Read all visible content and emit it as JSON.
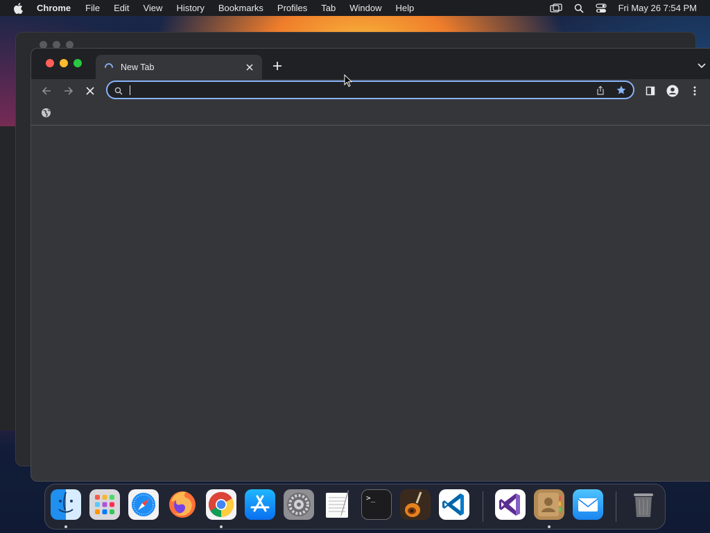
{
  "menubar": {
    "app_name": "Chrome",
    "items": [
      "File",
      "Edit",
      "View",
      "History",
      "Bookmarks",
      "Profiles",
      "Tab",
      "Window",
      "Help"
    ],
    "clock": "Fri May 26  7:54 PM",
    "status_icons": [
      "screen-mirroring-icon",
      "spotlight-search-icon",
      "control-center-icon"
    ]
  },
  "browser": {
    "tab_title": "New Tab",
    "tab_state": "loading",
    "omnibox": {
      "value": "",
      "placeholder": "",
      "focused": true
    },
    "accent_color": "#8ab4f8",
    "bookmark_color": "#8ab4f8"
  },
  "dock": {
    "apps": [
      {
        "name": "Finder",
        "icon": "finder-icon",
        "running": true
      },
      {
        "name": "Launchpad",
        "icon": "launchpad-icon",
        "running": false
      },
      {
        "name": "Safari",
        "icon": "safari-icon",
        "running": false
      },
      {
        "name": "Firefox",
        "icon": "firefox-icon",
        "running": false
      },
      {
        "name": "Google Chrome",
        "icon": "chrome-icon",
        "running": true
      },
      {
        "name": "App Store",
        "icon": "app-store-icon",
        "running": false
      },
      {
        "name": "System Preferences",
        "icon": "system-preferences-icon",
        "running": false
      },
      {
        "name": "TextEdit",
        "icon": "textedit-icon",
        "running": false
      },
      {
        "name": "Terminal",
        "icon": "terminal-icon",
        "running": false
      },
      {
        "name": "GarageBand",
        "icon": "garageband-icon",
        "running": false
      },
      {
        "name": "Visual Studio Code",
        "icon": "vscode-icon",
        "running": false
      },
      {
        "name": "Visual Studio",
        "icon": "visual-studio-icon",
        "running": false
      },
      {
        "name": "Contacts",
        "icon": "contacts-icon",
        "running": true
      },
      {
        "name": "Mail",
        "icon": "mail-icon",
        "running": false
      },
      {
        "name": "Trash",
        "icon": "trash-icon",
        "running": false
      }
    ],
    "terminal_prompt": ">_"
  }
}
